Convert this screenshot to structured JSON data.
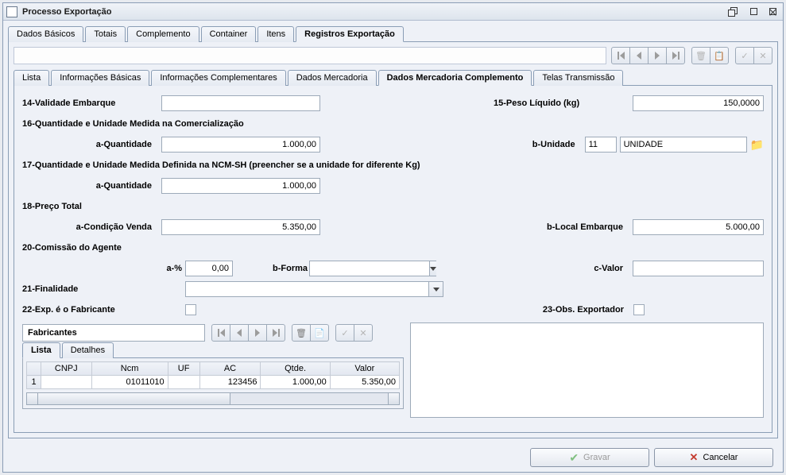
{
  "window": {
    "title": "Processo Exportação"
  },
  "mainTabs": [
    {
      "label": "Dados Básicos",
      "active": false
    },
    {
      "label": "Totais",
      "active": false
    },
    {
      "label": "Complemento",
      "active": false
    },
    {
      "label": "Container",
      "active": false
    },
    {
      "label": "Itens",
      "active": false
    },
    {
      "label": "Registros Exportação",
      "active": true
    }
  ],
  "detailTabs": [
    {
      "label": "Lista",
      "active": false
    },
    {
      "label": "Informações Básicas",
      "active": false
    },
    {
      "label": "Informações Complementares",
      "active": false
    },
    {
      "label": "Dados Mercadoria",
      "active": false
    },
    {
      "label": "Dados Mercadoria Complemento",
      "active": true
    },
    {
      "label": "Telas Transmissão",
      "active": false
    }
  ],
  "fields": {
    "l14": "14-Validade Embarque",
    "l15": "15-Peso Líquido (kg)",
    "v15": "150,0000",
    "l16": "16-Quantidade e Unidade Medida na Comercialização",
    "l16a": "a-Quantidade",
    "v16a": "1.000,00",
    "l16b": "b-Unidade",
    "v16b_code": "11",
    "v16b_desc": "UNIDADE",
    "l17": "17-Quantidade e Unidade Medida Definida na NCM-SH (preencher se a unidade for diferente Kg)",
    "l17a": "a-Quantidade",
    "v17a": "1.000,00",
    "l18": "18-Preço Total",
    "l18a": "a-Condição Venda",
    "v18a": "5.350,00",
    "l18b": "b-Local Embarque",
    "v18b": "5.000,00",
    "l20": "20-Comissão do Agente",
    "l20a": "a-%",
    "v20a": "0,00",
    "l20b": "b-Forma",
    "l20c": "c-Valor",
    "l21": "21-Finalidade",
    "l22": "22-Exp. é o Fabricante",
    "l23": "23-Obs. Exportador"
  },
  "fabricantes": {
    "title": "Fabricantes",
    "tabs": [
      {
        "label": "Lista",
        "active": true
      },
      {
        "label": "Detalhes",
        "active": false
      }
    ],
    "columns": [
      "CNPJ",
      "Ncm",
      "UF",
      "AC",
      "Qtde.",
      "Valor"
    ],
    "rows": [
      {
        "n": "1",
        "cnpj": "",
        "ncm": "01011010",
        "uf": "",
        "ac": "123456",
        "qtde": "1.000,00",
        "valor": "5.350,00"
      }
    ]
  },
  "footer": {
    "save": "Gravar",
    "cancel": "Cancelar"
  }
}
